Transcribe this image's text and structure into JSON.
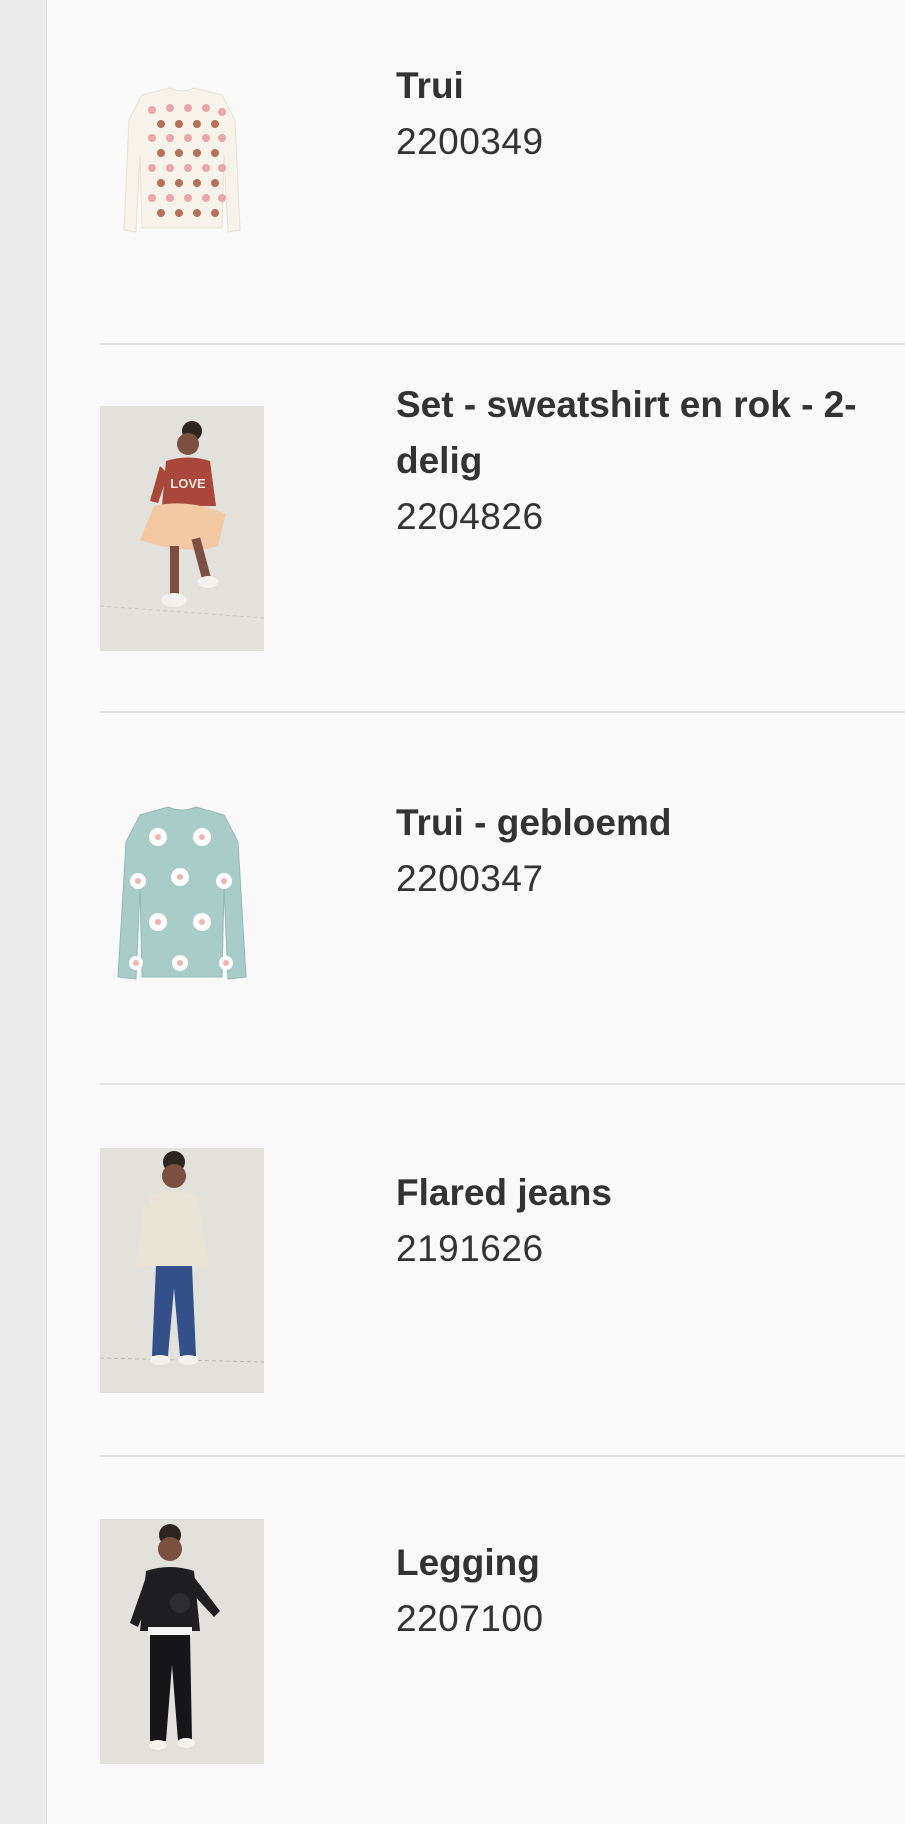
{
  "products": [
    {
      "name": "Trui",
      "code": "2200349",
      "image": "heart-pattern-sweater"
    },
    {
      "name": "Set - sweatshirt en rok - 2-delig",
      "code": "2204826",
      "image": "girl-love-sweatshirt-tulle-skirt"
    },
    {
      "name": "Trui - gebloemd",
      "code": "2200347",
      "image": "flower-pattern-sweater"
    },
    {
      "name": "Flared jeans",
      "code": "2191626",
      "image": "girl-flared-jeans"
    },
    {
      "name": "Legging",
      "code": "2207100",
      "image": "girl-black-legging"
    }
  ],
  "colors": {
    "text": "#333333",
    "divider": "#e4e4e4",
    "rail": "#ececec",
    "panel": "#f9f9f9"
  },
  "image_text": {
    "sweatshirt_print": "LOVE"
  }
}
